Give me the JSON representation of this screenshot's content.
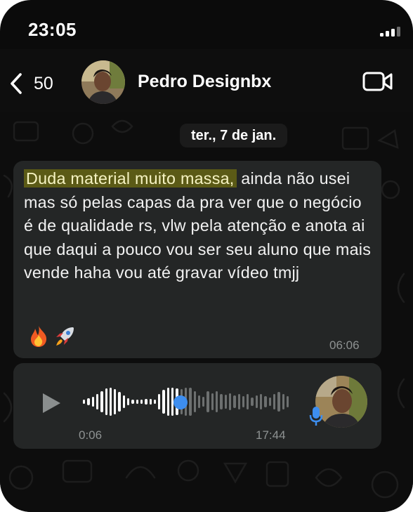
{
  "status_bar": {
    "time": "23:05"
  },
  "header": {
    "back_count": "50",
    "contact_name": "Pedro Designbx",
    "icons": [
      "chevron-left-icon",
      "video-call-icon"
    ]
  },
  "chat": {
    "date_label": "ter., 7 de jan.",
    "message": {
      "highlighted_text": "Duda material muito massa,",
      "text": " ainda não usei mas só pelas capas da pra ver que o negócio é de qualidade rs, vlw pela atenção e anota ai que daqui a pouco vou ser seu aluno que mais vende haha vou até gravar vídeo tmjj",
      "emojis": [
        "fire-icon",
        "rocket-icon"
      ],
      "time": "06:06"
    },
    "voice_message": {
      "elapsed": "0:06",
      "time": "17:44",
      "progress": 0.47
    }
  },
  "colors": {
    "bubble": "#242626",
    "highlight": "#5b5a16",
    "accent_blue": "#3d8ef0",
    "meta_text": "#8e9292"
  }
}
